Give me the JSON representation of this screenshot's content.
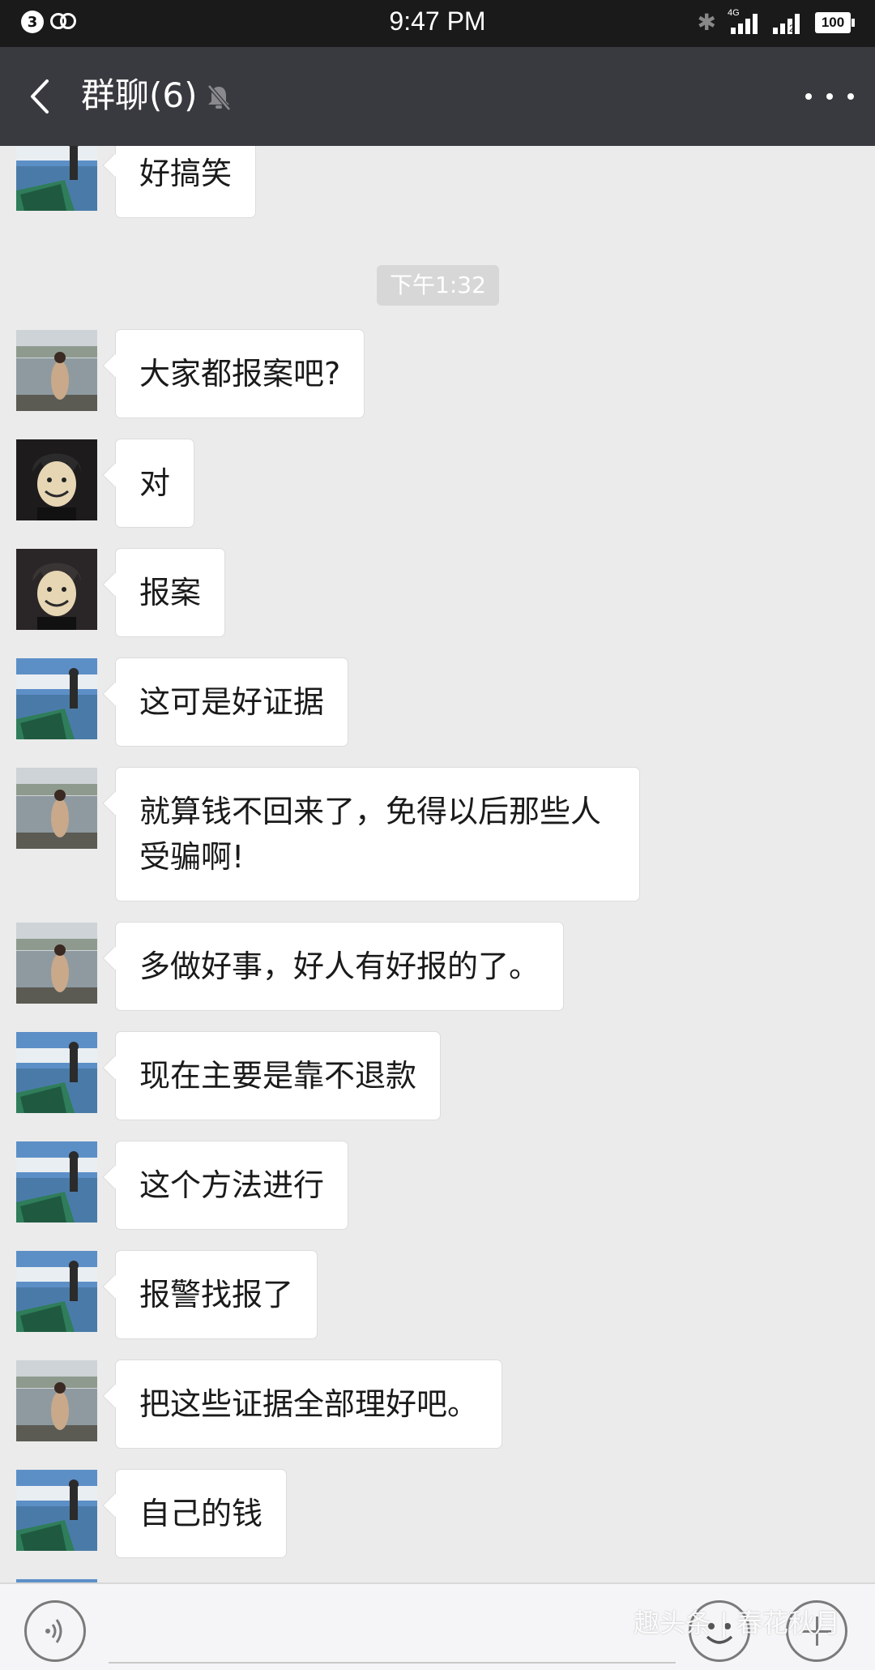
{
  "status_bar": {
    "notification_count": "3",
    "time": "9:47 PM",
    "network_label": "4G",
    "sim2_label": "2",
    "battery_level": "100"
  },
  "header": {
    "title": "群聊(6)",
    "back_icon": "back-chevron-icon",
    "mute_icon": "muted-bell-icon",
    "more_icon": "more-dots-icon",
    "background_color": "#393a3f"
  },
  "chat": {
    "background_color": "#ebebeb",
    "messages_before_time": [
      {
        "sender": "lake-boat",
        "text": "好搞笑"
      }
    ],
    "timestamp": "下午1:32",
    "messages": [
      {
        "sender": "woman-by-lake",
        "text": "大家都报案吧?"
      },
      {
        "sender": "mask-man",
        "text": "对"
      },
      {
        "sender": "mask-man",
        "text": "报案"
      },
      {
        "sender": "lake-boat",
        "text": "这可是好证据"
      },
      {
        "sender": "woman-by-lake",
        "line1": "就算钱不回来了，免得以后那些人",
        "line2": "受骗啊!"
      },
      {
        "sender": "woman-by-lake",
        "text": "多做好事，好人有好报的了。"
      },
      {
        "sender": "lake-boat",
        "text": "现在主要是靠不退款"
      },
      {
        "sender": "lake-boat",
        "text": "这个方法进行"
      },
      {
        "sender": "lake-boat",
        "text": "报警找报了"
      },
      {
        "sender": "woman-by-lake",
        "text": "把这些证据全部理好吧。"
      },
      {
        "sender": "lake-boat",
        "text": "自己的钱"
      }
    ]
  },
  "input_bar": {
    "voice_icon": "voice-icon",
    "emoji_icon": "emoji-icon",
    "plus_icon": "plus-icon",
    "watermark": "趣头条 | 春花秋月"
  }
}
